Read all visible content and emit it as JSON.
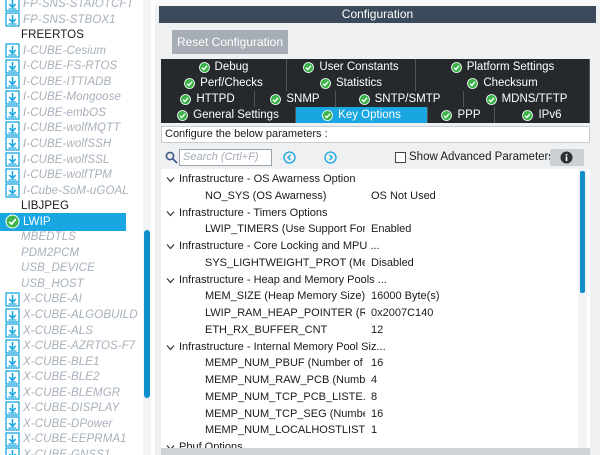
{
  "tree": {
    "items": [
      {
        "label": "FP-SNS-STAIOTCFT",
        "state": "inactive"
      },
      {
        "label": "FP-SNS-STBOX1",
        "state": "inactive"
      },
      {
        "label": "FREERTOS",
        "state": "plain"
      },
      {
        "label": "I-CUBE-Cesium",
        "state": "inactive"
      },
      {
        "label": "I-CUBE-FS-RTOS",
        "state": "inactive"
      },
      {
        "label": "I-CUBE-ITTIADB",
        "state": "inactive"
      },
      {
        "label": "I-CUBE-Mongoose",
        "state": "inactive"
      },
      {
        "label": "I-CUBE-embOS",
        "state": "inactive"
      },
      {
        "label": "I-CUBE-wolfMQTT",
        "state": "inactive"
      },
      {
        "label": "I-CUBE-wolfSSH",
        "state": "inactive"
      },
      {
        "label": "I-CUBE-wolfSSL",
        "state": "inactive"
      },
      {
        "label": "I-CUBE-wolfTPM",
        "state": "inactive"
      },
      {
        "label": "I-Cube-SoM-uGOAL",
        "state": "inactive"
      },
      {
        "label": "LIBJPEG",
        "state": "plain"
      },
      {
        "label": "LWIP",
        "state": "selected"
      },
      {
        "label": "MBEDTLS",
        "state": "disabled"
      },
      {
        "label": "PDM2PCM",
        "state": "disabled"
      },
      {
        "label": "USB_DEVICE",
        "state": "disabled"
      },
      {
        "label": "USB_HOST",
        "state": "disabled"
      },
      {
        "label": "X-CUBE-AI",
        "state": "inactive"
      },
      {
        "label": "X-CUBE-ALGOBUILD",
        "state": "inactive"
      },
      {
        "label": "X-CUBE-ALS",
        "state": "inactive"
      },
      {
        "label": "X-CUBE-AZRTOS-F7",
        "state": "inactive"
      },
      {
        "label": "X-CUBE-BLE1",
        "state": "inactive"
      },
      {
        "label": "X-CUBE-BLE2",
        "state": "inactive"
      },
      {
        "label": "X-CUBE-BLEMGR",
        "state": "inactive"
      },
      {
        "label": "X-CUBE-DISPLAY",
        "state": "inactive"
      },
      {
        "label": "X-CUBE-DPower",
        "state": "inactive"
      },
      {
        "label": "X-CUBE-EEPRMA1",
        "state": "inactive"
      },
      {
        "label": "X-CUBE-GNSS1",
        "state": "inactive"
      }
    ]
  },
  "config": {
    "header": "Configuration",
    "reset_label": "Reset Configuration",
    "tabs_row1": [
      "Debug",
      "User Constants",
      "Platform Settings"
    ],
    "tabs_row2": [
      "Perf/Checks",
      "Statistics",
      "Checksum"
    ],
    "tabs_row3": [
      "HTTPD",
      "SNMP",
      "SNTP/SMTP",
      "MDNS/TFTP"
    ],
    "tabs_row4": [
      "General Settings",
      "Key Options",
      "PPP",
      "IPv6"
    ],
    "active_tab": "Key Options",
    "instruction": "Configure the below parameters :",
    "search_placeholder": "Search (Crtl+F)",
    "show_advanced_label": "Show Advanced Parameters",
    "show_advanced_checked": false
  },
  "params": [
    {
      "type": "group",
      "name": "Infrastructure - OS Awarness Option"
    },
    {
      "type": "param",
      "name": "NO_SYS (OS Awarness)",
      "value": "OS Not Used"
    },
    {
      "type": "group",
      "name": "Infrastructure - Timers Options"
    },
    {
      "type": "param",
      "name": "LWIP_TIMERS (Use Support For ...",
      "value": "Enabled"
    },
    {
      "type": "group",
      "name": "Infrastructure - Core Locking and MPU ..."
    },
    {
      "type": "param",
      "name": "SYS_LIGHTWEIGHT_PROT (Me...",
      "value": "Disabled"
    },
    {
      "type": "group",
      "name": "Infrastructure - Heap and Memory Pools ..."
    },
    {
      "type": "param",
      "name": "MEM_SIZE (Heap Memory Size)",
      "value": "16000 Byte(s)"
    },
    {
      "type": "param",
      "name": "LWIP_RAM_HEAP_POINTER (R...",
      "value": "0x2007C140"
    },
    {
      "type": "param",
      "name": "ETH_RX_BUFFER_CNT",
      "value": "12"
    },
    {
      "type": "group",
      "name": "Infrastructure - Internal Memory Pool Siz..."
    },
    {
      "type": "param",
      "name": "MEMP_NUM_PBUF (Number of ...",
      "value": "16"
    },
    {
      "type": "param",
      "name": "MEMP_NUM_RAW_PCB (Numb...",
      "value": "4"
    },
    {
      "type": "param",
      "name": "MEMP_NUM_TCP_PCB_LISTE...",
      "value": "8"
    },
    {
      "type": "param",
      "name": "MEMP_NUM_TCP_SEG (Numbe...",
      "value": "16"
    },
    {
      "type": "param",
      "name": "MEMP_NUM_LOCALHOSTLIST ...",
      "value": "1"
    },
    {
      "type": "group",
      "name": "Pbuf Options"
    }
  ],
  "colors": {
    "accent": "#1aa6e0",
    "tab_bg": "#25292c",
    "header_bg": "#3b4a5a",
    "scroll": "#0f8ecb",
    "check_green": "#3bb54a"
  },
  "icons": {
    "tree_item": "component-download-icon",
    "selected": "check-circle-icon",
    "tab": "check-circle-icon"
  }
}
